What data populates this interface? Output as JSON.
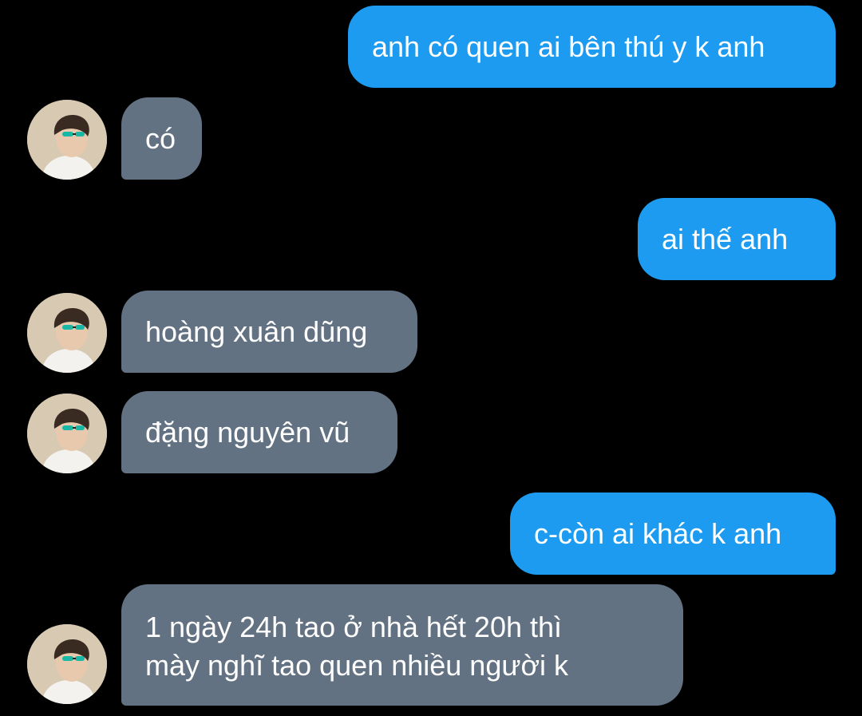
{
  "conversation": {
    "messages": [
      {
        "side": "sent",
        "text": "anh có quen ai bên thú y k anh"
      },
      {
        "side": "received",
        "text": "có"
      },
      {
        "side": "sent",
        "text": "ai thế anh"
      },
      {
        "side": "received",
        "text": "hoàng xuân dũng"
      },
      {
        "side": "received",
        "text": "đặng nguyên vũ"
      },
      {
        "side": "sent",
        "text": "c-còn ai khác k anh"
      },
      {
        "side": "received",
        "text": "1 ngày 24h tao ở nhà hết 20h thì\nmày nghĩ tao quen nhiều người k"
      }
    ]
  },
  "colors": {
    "background": "#000000",
    "sent_bubble": "#1d9bf0",
    "received_bubble": "#637282",
    "text": "#ffffff"
  },
  "icons": {
    "avatar": "user-avatar-photo"
  }
}
